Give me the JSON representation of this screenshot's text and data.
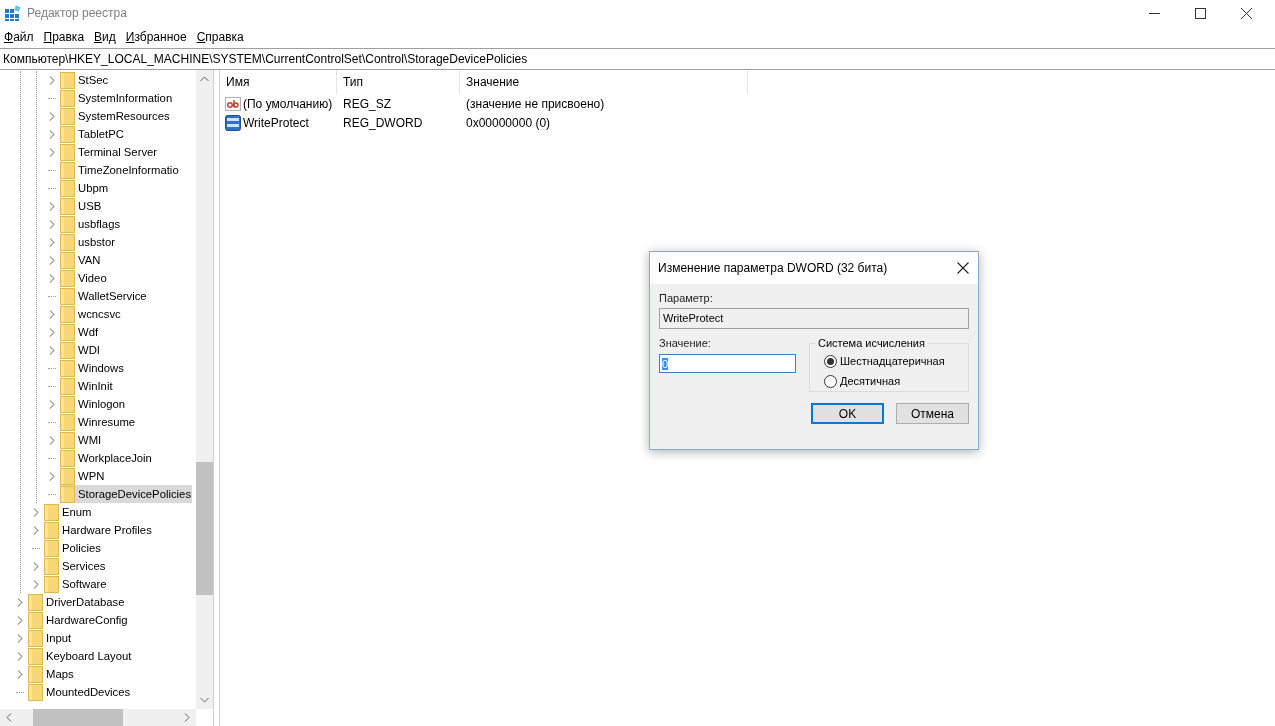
{
  "window": {
    "title": "Редактор реестра"
  },
  "menu": [
    "Файл",
    "Правка",
    "Вид",
    "Избранное",
    "Справка"
  ],
  "address": "Компьютер\\HKEY_LOCAL_MACHINE\\SYSTEM\\CurrentControlSet\\Control\\StorageDevicePolicies",
  "tree": [
    {
      "children": [
        {
          "children": [
            {
              "label": "StSec",
              "has_children": true,
              "selected": false
            },
            {
              "label": "SystemInformation",
              "has_children": false,
              "selected": false
            },
            {
              "label": "SystemResources",
              "has_children": true,
              "selected": false
            },
            {
              "label": "TabletPC",
              "has_children": true,
              "selected": false
            },
            {
              "label": "Terminal Server",
              "has_children": true,
              "selected": false
            },
            {
              "label": "TimeZoneInformatio",
              "has_children": false,
              "selected": false
            },
            {
              "label": "Ubpm",
              "has_children": false,
              "selected": false
            },
            {
              "label": "USB",
              "has_children": true,
              "selected": false
            },
            {
              "label": "usbflags",
              "has_children": true,
              "selected": false
            },
            {
              "label": "usbstor",
              "has_children": true,
              "selected": false
            },
            {
              "label": "VAN",
              "has_children": true,
              "selected": false
            },
            {
              "label": "Video",
              "has_children": true,
              "selected": false
            },
            {
              "label": "WalletService",
              "has_children": false,
              "selected": false
            },
            {
              "label": "wcncsvc",
              "has_children": true,
              "selected": false
            },
            {
              "label": "Wdf",
              "has_children": true,
              "selected": false
            },
            {
              "label": "WDI",
              "has_children": true,
              "selected": false
            },
            {
              "label": "Windows",
              "has_children": false,
              "selected": false
            },
            {
              "label": "WinInit",
              "has_children": false,
              "selected": false
            },
            {
              "label": "Winlogon",
              "has_children": true,
              "selected": false
            },
            {
              "label": "Winresume",
              "has_children": false,
              "selected": false
            },
            {
              "label": "WMI",
              "has_children": true,
              "selected": false
            },
            {
              "label": "WorkplaceJoin",
              "has_children": false,
              "selected": false
            },
            {
              "label": "WPN",
              "has_children": true,
              "selected": false
            },
            {
              "label": "StorageDevicePolicies",
              "has_children": false,
              "selected": true
            }
          ]
        },
        {
          "label": "Enum",
          "has_children": true,
          "selected": false
        },
        {
          "label": "Hardware Profiles",
          "has_children": true,
          "selected": false
        },
        {
          "label": "Policies",
          "has_children": false,
          "selected": false
        },
        {
          "label": "Services",
          "has_children": true,
          "selected": false
        },
        {
          "label": "Software",
          "has_children": true,
          "selected": false
        }
      ]
    },
    {
      "label": "DriverDatabase",
      "has_children": true,
      "selected": false
    },
    {
      "label": "HardwareConfig",
      "has_children": true,
      "selected": false
    },
    {
      "label": "Input",
      "has_children": true,
      "selected": false
    },
    {
      "label": "Keyboard Layout",
      "has_children": true,
      "selected": false
    },
    {
      "label": "Maps",
      "has_children": true,
      "selected": false
    },
    {
      "label": "MountedDevices",
      "has_children": false,
      "selected": false
    }
  ],
  "values": {
    "columns": [
      "Имя",
      "Тип",
      "Значение"
    ],
    "rows": [
      {
        "kind": "string",
        "name": "(По умолчанию)",
        "type": "REG_SZ",
        "data": "(значение не присвоено)"
      },
      {
        "kind": "dword",
        "name": "WriteProtect",
        "type": "REG_DWORD",
        "data": "0x00000000 (0)"
      }
    ]
  },
  "dialog": {
    "title": "Изменение параметра DWORD (32 бита)",
    "parameter_label": "Параметр:",
    "parameter_value": "WriteProtect",
    "value_label": "Значение:",
    "value": "0",
    "radix_group": "Система исчисления",
    "radix_options": [
      {
        "label": "Шестнадцатеричная",
        "selected": true
      },
      {
        "label": "Десятичная",
        "selected": false
      }
    ],
    "buttons": [
      {
        "label": "OK",
        "default": true
      },
      {
        "label": "Отмена",
        "default": false
      }
    ]
  }
}
